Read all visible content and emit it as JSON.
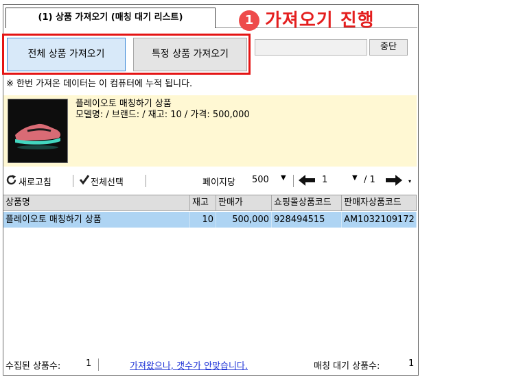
{
  "tab": {
    "label": "(1) 상품 가져오기 (매칭 대기 리스트)"
  },
  "callout": {
    "step": "1",
    "text": "가져오기 진행"
  },
  "buttons": {
    "fetch_all": "전체 상품 가져오기",
    "fetch_specific": "특정 상품 가져오기",
    "stop": "중단"
  },
  "note": "※ 한번 가져온 데이터는 이 컴퓨터에 누적 됩니다.",
  "product": {
    "name": "플레이오토 매칭하기 상품",
    "meta": "모델명:  / 브랜드:  / 재고: 10 / 가격: 500,000",
    "thumb_icon": "sneaker-image"
  },
  "toolbar": {
    "refresh": "새로고침",
    "select_all": "전체선택",
    "per_page_label": "페이지당",
    "per_page_value": "500",
    "page_current": "1",
    "page_total": "/ 1"
  },
  "table": {
    "headers": [
      "상품명",
      "재고",
      "판매가",
      "쇼핑몰상품코드",
      "판매자상품코드"
    ],
    "rows": [
      [
        "플레이오토 매칭하기 상품",
        "10",
        "500,000",
        "928494515",
        "AM1032109172"
      ]
    ]
  },
  "status": {
    "collected_label": "수집된 상품수:",
    "collected_value": "1",
    "link": "가져왔으나, 갯수가 안맞습니다.",
    "pending_label": "매칭 대기 상품수:",
    "pending_value": "1"
  },
  "colors": {
    "accent_red": "#e41e1e",
    "selection": "#aed4f3",
    "product_bg": "#fff8d3",
    "link": "#1a2fd6"
  }
}
